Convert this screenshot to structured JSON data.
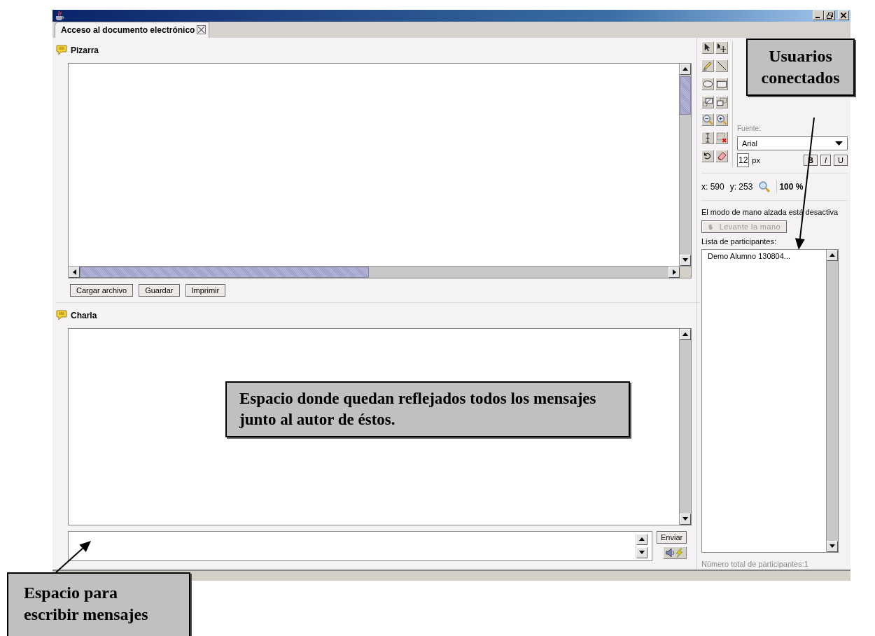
{
  "tabs": [
    {
      "label": "Acceso al documento electrónico",
      "selected": true
    }
  ],
  "whiteboard": {
    "title": "Pizarra",
    "buttons": [
      "Cargar archivo",
      "Guardar",
      "Imprimir"
    ]
  },
  "chat": {
    "title": "Charla",
    "send_button": "Enviar"
  },
  "font": {
    "label": "Fuente:",
    "value": "Arial",
    "size": "12",
    "unit": "px",
    "style_buttons": [
      "B",
      "I",
      "U"
    ]
  },
  "coordinates": {
    "x": "x: 590",
    "y": "y: 253",
    "zoom": "100 %"
  },
  "hand_raise": {
    "status": "El modo de mano alzada está desactiva",
    "button": "Levante la mano",
    "disabled": true
  },
  "participants": {
    "label": "Lista de participantes:",
    "items": [
      "Demo Alumno 130804..."
    ],
    "total": "Número total de participantes:1"
  },
  "annotations": [
    {
      "text": "Usuarios conectados"
    },
    {
      "text": "Espacio donde quedan reflejados todos los mensajes junto al autor de éstos."
    },
    {
      "text": "Espacio para escribir mensajes"
    }
  ]
}
